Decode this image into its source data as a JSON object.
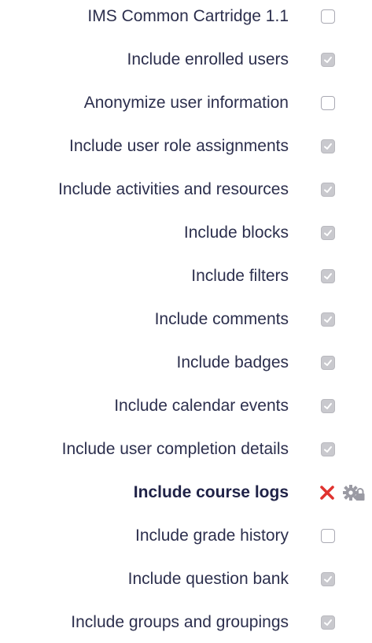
{
  "settings": [
    {
      "label": "IMS Common Cartridge 1.1",
      "checked": false
    },
    {
      "label": "Include enrolled users",
      "checked": true
    },
    {
      "label": "Anonymize user information",
      "checked": false
    },
    {
      "label": "Include user role assignments",
      "checked": true
    },
    {
      "label": "Include activities and resources",
      "checked": true
    },
    {
      "label": "Include blocks",
      "checked": true
    },
    {
      "label": "Include filters",
      "checked": true
    },
    {
      "label": "Include comments",
      "checked": true
    },
    {
      "label": "Include badges",
      "checked": true
    },
    {
      "label": "Include calendar events",
      "checked": true
    },
    {
      "label": "Include user completion details",
      "checked": true
    },
    {
      "label": "Include course logs",
      "locked": true,
      "icons": [
        "cross-icon",
        "gear-lock-icon"
      ]
    },
    {
      "label": "Include grade history",
      "checked": false
    },
    {
      "label": "Include question bank",
      "checked": true
    },
    {
      "label": "Include groups and groupings",
      "checked": true
    }
  ],
  "colors": {
    "text": "#2c2f4d",
    "cross": "#e0332f",
    "gear": "#9a9aa3",
    "checkbox_checked_bg": "#c9c9ce"
  }
}
